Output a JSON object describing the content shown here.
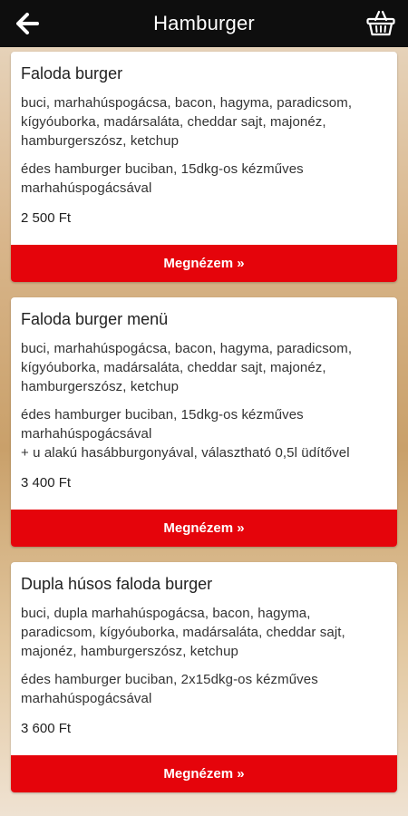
{
  "header": {
    "title": "Hamburger",
    "back_icon": "back-arrow-icon",
    "cart_icon": "basket-icon"
  },
  "products": [
    {
      "name": "Faloda burger",
      "ingredients": "buci, marhahúspogácsa, bacon, hagyma, paradicsom, kígyóuborka, madársaláta, cheddar sajt, majonéz, hamburgerszósz, ketchup",
      "description": "édes hamburger buciban, 15dkg-os kézműves marhahúspogácsával",
      "price": "2 500 Ft",
      "button_label": "Megnézem »"
    },
    {
      "name": "Faloda burger menü",
      "ingredients": "buci, marhahúspogácsa, bacon, hagyma, paradicsom, kígyóuborka, madársaláta, cheddar sajt, majonéz, hamburgerszósz, ketchup",
      "description": "édes hamburger buciban, 15dkg-os kézműves marhahúspogácsával\n+ u alakú hasábburgonyával, választható 0,5l üdítővel",
      "price": "3 400 Ft",
      "button_label": "Megnézem »"
    },
    {
      "name": "Dupla húsos faloda burger",
      "ingredients": "buci, dupla marhahúspogácsa, bacon, hagyma, paradicsom, kígyóuborka, madársaláta, cheddar sajt, majonéz, hamburgerszósz, ketchup",
      "description": "édes hamburger buciban, 2x15dkg-os kézműves marhahúspogácsával",
      "price": "3 600 Ft",
      "button_label": "Megnézem »"
    }
  ],
  "colors": {
    "header_bg": "#0e0e0e",
    "button_bg": "#e5040b",
    "card_bg": "#ffffff"
  }
}
